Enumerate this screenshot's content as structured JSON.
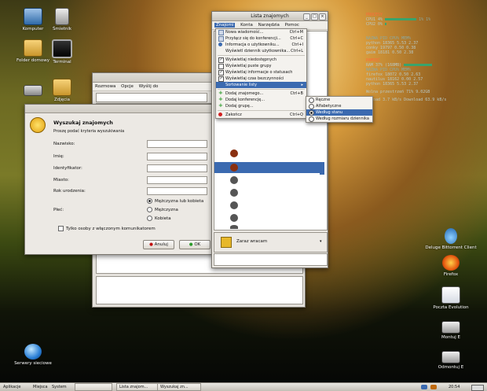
{
  "desktop": {
    "icons": [
      {
        "label": "Komputer"
      },
      {
        "label": "Śmietnik"
      },
      {
        "label": "Folder domowy"
      },
      {
        "label": "Terminal"
      },
      {
        "label": "Zdjęcia"
      },
      {
        "label": "Serwery sieciowe"
      },
      {
        "label": "Deluge Bittorrent Client"
      },
      {
        "label": "Firefox"
      },
      {
        "label": "Poczta Evolution"
      },
      {
        "label": "Montuj E"
      },
      {
        "label": "Odmontuj E"
      }
    ]
  },
  "conky": {
    "proces_head": "PROCESY",
    "cpu1": "CPU1 4%",
    "cpu2": "CPU2 0%",
    "cpu_right": "1% 1%",
    "proc_header": "NAZWA   PID    CPU%  MEM%",
    "proc_rows": [
      "python   18365  5.53  2.37",
      "conky    19797  0.50  0.38",
      "gaim     18181  0.50  2.38"
    ],
    "ram_head": "PAMIĘĆ",
    "ram": "RAM  37% (168MB)",
    "mem_header": "NAZWA   PID    CPU%  MEM%",
    "mem_rows": [
      "firefox  18072  0.50  2.63",
      "nautilus 18162  0.00  2.57",
      "python   18365  5.53  2.37"
    ],
    "disk": "Wolna przestrzeń  71% 9.02GB",
    "net": "Upload  3.7  kB/s       Download  63.9  kB/s"
  },
  "contacts": {
    "title": "Lista znajomych",
    "menu": [
      "Znajomi",
      "Konta",
      "Narzędzia",
      "Pomoc"
    ],
    "status": "Zaraz wracam"
  },
  "menu_znajomi": {
    "items": [
      {
        "label": "Nowa wiadomość...",
        "shortcut": "Ctrl+M"
      },
      {
        "label": "Przyłącz się do konferencji...",
        "shortcut": "Ctrl+C"
      },
      {
        "label": "Informacja o użytkowniku...",
        "shortcut": "Ctrl+I"
      },
      {
        "label": "Wyświetl dziennik użytkownika...",
        "shortcut": "Ctrl+L"
      },
      {
        "label": "Wyświetlaj niedostępnych",
        "shortcut": ""
      },
      {
        "label": "Wyświetlaj puste grupy",
        "shortcut": ""
      },
      {
        "label": "Wyświetlaj informacje o statusach",
        "shortcut": ""
      },
      {
        "label": "Wyświetlaj czas bezczynności",
        "shortcut": ""
      },
      {
        "label": "Sortowanie listy",
        "shortcut": ""
      },
      {
        "label": "Dodaj znajomego...",
        "shortcut": "Ctrl+B"
      },
      {
        "label": "Dodaj konferencję...",
        "shortcut": ""
      },
      {
        "label": "Dodaj grupę...",
        "shortcut": ""
      },
      {
        "label": "Zakończ",
        "shortcut": "Ctrl+Q"
      }
    ]
  },
  "menu_sort": {
    "items": [
      {
        "label": "Ręczne"
      },
      {
        "label": "Alfabetyczne"
      },
      {
        "label": "Według stanu"
      },
      {
        "label": "Według rozmiaru dziennika"
      }
    ]
  },
  "bg_window": {
    "menu": [
      "Rozmowa",
      "Opcje",
      "Wyślij do"
    ]
  },
  "search": {
    "title": "Wyszukaj znajomych",
    "subtitle": "Proszę podać kryteria wyszukiwania",
    "labels": [
      "Nazwisko:",
      "Imię:",
      "Identyfikator:",
      "Miasto:",
      "Rok urodzenia:",
      "Płeć:"
    ],
    "gender": [
      "Mężczyzna lub kobieta",
      "Mężczyzna",
      "Kobieta"
    ],
    "only_online": "Tylko osoby z włączonym komunikatorem",
    "cancel": "Anuluj",
    "ok": "OK"
  },
  "taskbar": {
    "apps": "Aplikacje",
    "places": "Miejsca",
    "system": "System",
    "task1": "Lista znajom...",
    "task2": "Wyszukaj zn...",
    "clock": "20:54"
  }
}
